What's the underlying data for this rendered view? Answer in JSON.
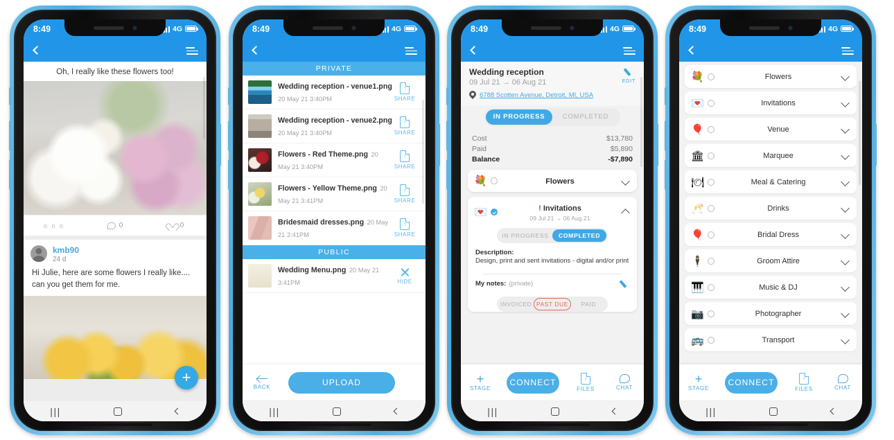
{
  "status_bar": {
    "time": "8:49",
    "network": "4G"
  },
  "phone1": {
    "post": {
      "caption": "Oh, I really like these flowers too!",
      "dots": "o o o",
      "comment_count": "0",
      "like_count": "0"
    },
    "comment": {
      "user": "kmb90",
      "time": "24 d",
      "text": "Hi Julie, here are some flowers I really like.... can you get them for me."
    },
    "fab_label": "+"
  },
  "phone2": {
    "sections": [
      {
        "header": "PRIVATE",
        "files": [
          {
            "name": "Wedding reception - venue1.png",
            "date": "20 May 21 3:40PM",
            "action": "SHARE",
            "action_icon": "share-doc-icon",
            "thumb": "th-venue1"
          },
          {
            "name": "Wedding reception - venue2.png",
            "date": "20 May 21 3:40PM",
            "action": "SHARE",
            "action_icon": "share-doc-icon",
            "thumb": "th-venue2"
          },
          {
            "name": "Flowers - Red Theme.png",
            "date": "20 May 21 3:40PM",
            "action": "SHARE",
            "action_icon": "share-doc-icon",
            "thumb": "th-red"
          },
          {
            "name": "Flowers - Yellow Theme.png",
            "date": "20 May 21 3:41PM",
            "action": "SHARE",
            "action_icon": "share-doc-icon",
            "thumb": "th-yellow"
          },
          {
            "name": "Bridesmaid dresses.png",
            "date": "20 May 21 3:41PM",
            "action": "SHARE",
            "action_icon": "share-doc-icon",
            "thumb": "th-dress"
          }
        ]
      },
      {
        "header": "PUBLIC",
        "files": [
          {
            "name": "Wedding Menu.png",
            "date": "20 May 21 3:41PM",
            "action": "HIDE",
            "action_icon": "close-x-icon",
            "thumb": "th-menu"
          }
        ]
      }
    ],
    "bottom": {
      "back_label": "BACK",
      "primary_label": "UPLOAD"
    }
  },
  "phone3": {
    "title": "Wedding reception",
    "dates": "09 Jul 21 → 06 Aug 21",
    "address": "6788 Scotten Avenue, Detroit, MI, USA",
    "edit_label": "EDIT",
    "status_tabs": [
      {
        "label": "IN PROGRESS",
        "active": true
      },
      {
        "label": "COMPLETED",
        "active": false
      }
    ],
    "money": [
      {
        "label": "Cost",
        "value": "$13,780",
        "bold": false
      },
      {
        "label": "Paid",
        "value": "$5,890",
        "bold": false
      },
      {
        "label": "Balance",
        "value": "-$7,890",
        "bold": true
      }
    ],
    "stages": [
      {
        "emoji": "💐",
        "name": "Flowers",
        "checked": false,
        "expanded": false,
        "caret": "chevron-down-icon"
      },
      {
        "emoji": "💌",
        "name": "Invitations",
        "alert": "!",
        "dates": "09 Jul 21 → 06 Aug 21",
        "checked": true,
        "expanded": true,
        "caret": "chevron-up-icon",
        "status_tabs": [
          {
            "label": "IN PROGRESS",
            "active": false
          },
          {
            "label": "COMPLETED",
            "active": true
          }
        ],
        "description_label": "Description:",
        "description_text": "Design, print and sent invitations - digital and/or print",
        "notes_label": "My notes:",
        "notes_value": "(private)",
        "payment_tabs": [
          {
            "label": "INVOICED",
            "state": "off"
          },
          {
            "label": "PAST DUE",
            "state": "due"
          },
          {
            "label": "PAID",
            "state": "off"
          }
        ]
      }
    ],
    "bottom": {
      "stage_label": "STAGE",
      "stage_icon": "+",
      "primary_label": "CONNECT",
      "files_label": "FILES",
      "chat_label": "CHAT"
    }
  },
  "phone4": {
    "categories": [
      {
        "emoji": "💐",
        "label": "Flowers"
      },
      {
        "emoji": "💌",
        "label": "Invitations"
      },
      {
        "emoji": "🎈",
        "label": "Venue"
      },
      {
        "emoji": "🏛",
        "label": "Marquee"
      },
      {
        "emoji": "🍽",
        "label": "Meal & Catering"
      },
      {
        "emoji": "🥂",
        "label": "Drinks"
      },
      {
        "emoji": "🎈",
        "label": "Bridal Dress"
      },
      {
        "emoji": "🕴",
        "label": "Groom Attire"
      },
      {
        "emoji": "🎹",
        "label": "Music & DJ"
      },
      {
        "emoji": "📷",
        "label": "Photographer"
      },
      {
        "emoji": "🚌",
        "label": "Transport"
      }
    ],
    "bottom": {
      "stage_label": "STAGE",
      "stage_icon": "+",
      "primary_label": "CONNECT",
      "files_label": "FILES",
      "chat_label": "CHAT"
    }
  },
  "colors": {
    "accent": "#2196e8",
    "accent_light": "#4aaee7",
    "alert": "#e23b2e",
    "past_due": "#e8655a"
  }
}
